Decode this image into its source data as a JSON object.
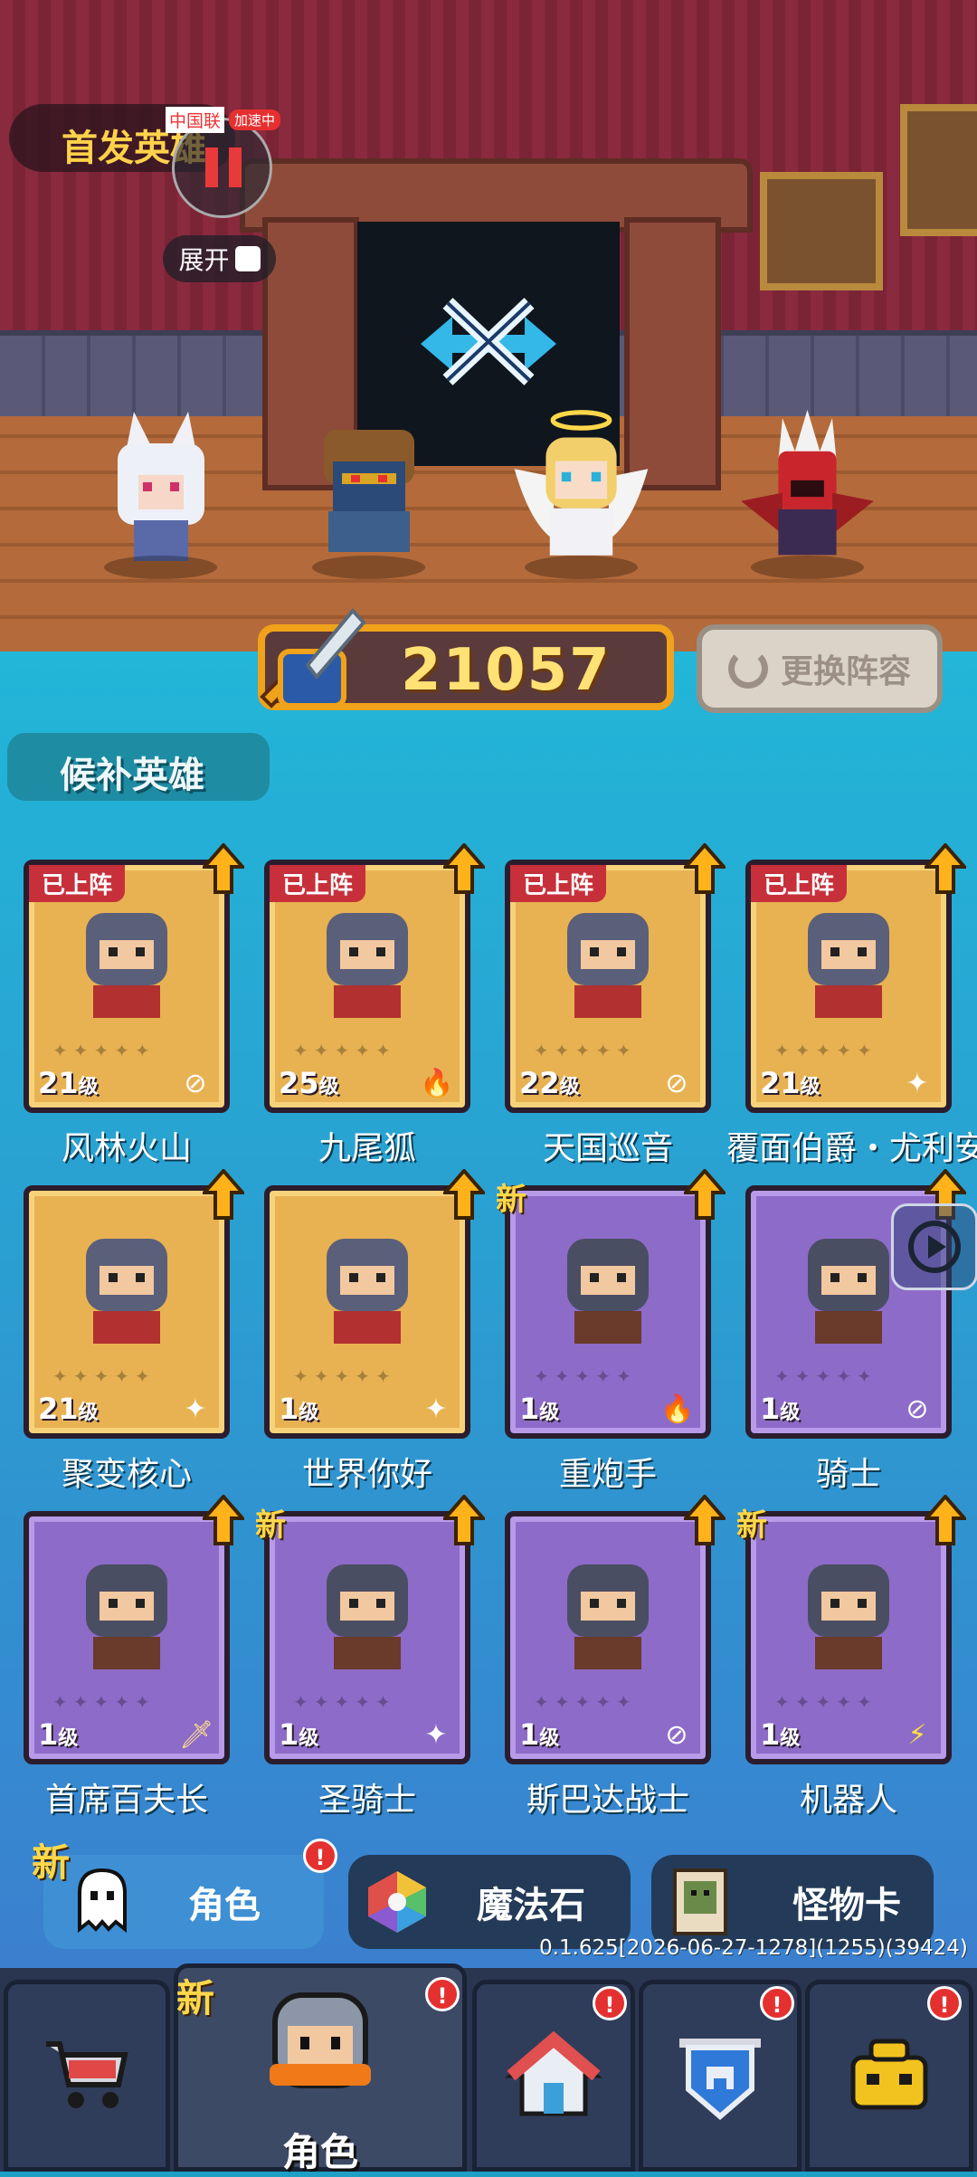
{
  "header": {
    "lineup_title": "首发英雄"
  },
  "floating_button": {
    "tag": "中国联",
    "speed_badge": "加速中",
    "expand_label": "展开"
  },
  "power": {
    "value": "21057"
  },
  "swap_button": {
    "label": "更换阵容"
  },
  "bench": {
    "tab_label": "候补英雄",
    "deployed_label": "已上阵",
    "new_label": "新",
    "level_suffix": "级",
    "heroes": [
      {
        "name": "风林火山",
        "level": "21",
        "deployed": true,
        "new": false,
        "rarity": "gold",
        "element": "neutral-icon"
      },
      {
        "name": "九尾狐",
        "level": "25",
        "deployed": true,
        "new": false,
        "rarity": "gold",
        "element": "fire-icon"
      },
      {
        "name": "天国巡音",
        "level": "22",
        "deployed": true,
        "new": false,
        "rarity": "gold",
        "element": "neutral-icon"
      },
      {
        "name": "覆面伯爵・尤利安",
        "level": "21",
        "deployed": true,
        "new": false,
        "rarity": "gold",
        "element": "star-icon"
      },
      {
        "name": "聚变核心",
        "level": "21",
        "deployed": false,
        "new": false,
        "rarity": "gold",
        "element": "star-icon"
      },
      {
        "name": "世界你好",
        "level": "1",
        "deployed": false,
        "new": false,
        "rarity": "gold",
        "element": "star-icon"
      },
      {
        "name": "重炮手",
        "level": "1",
        "deployed": false,
        "new": true,
        "rarity": "purple",
        "element": "fire-icon"
      },
      {
        "name": "骑士",
        "level": "1",
        "deployed": false,
        "new": false,
        "rarity": "purple",
        "element": "neutral-icon"
      },
      {
        "name": "首席百夫长",
        "level": "1",
        "deployed": false,
        "new": false,
        "rarity": "purple",
        "element": "sword-icon"
      },
      {
        "name": "圣骑士",
        "level": "1",
        "deployed": false,
        "new": true,
        "rarity": "purple",
        "element": "star-icon"
      },
      {
        "name": "斯巴达战士",
        "level": "1",
        "deployed": false,
        "new": false,
        "rarity": "purple",
        "element": "neutral-icon"
      },
      {
        "name": "机器人",
        "level": "1",
        "deployed": false,
        "new": true,
        "rarity": "purple",
        "element": "lightning-icon"
      }
    ]
  },
  "sub_tabs": {
    "character": "角色",
    "magic_stone": "魔法石",
    "monster_card": "怪物卡",
    "new_label": "新",
    "badge": "!"
  },
  "version": "0.1.625[2026-06-27-1278](1255)(39424)",
  "bottom_nav": {
    "active_label": "角色",
    "new_label": "新",
    "badge": "!"
  },
  "colors": {
    "gold_card": "#e8b252",
    "purple_card": "#8d6bc8",
    "accent_yellow": "#ffd24a",
    "badge_red": "#e53030"
  }
}
